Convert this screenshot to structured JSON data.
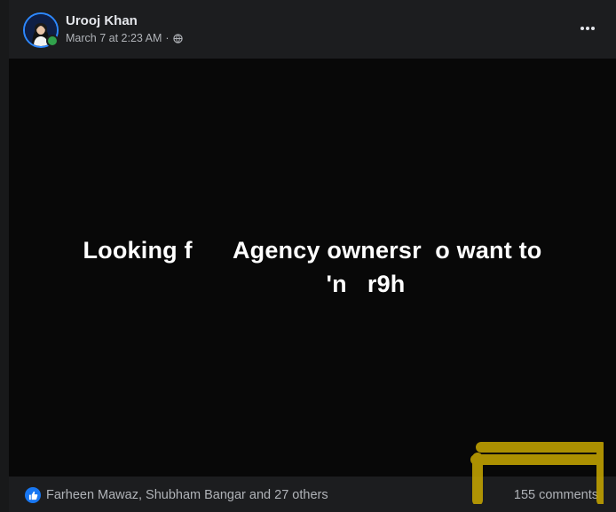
{
  "post": {
    "author": "Urooj Khan",
    "timestamp": "March 7 at 2:23 AM",
    "separator": "·",
    "audience_icon": "globe-icon",
    "more_icon": "more-horizontal-icon",
    "text_line1": "Looking f      Agency ownersr  o want to",
    "text_line2": "'n   r9h"
  },
  "footer": {
    "reaction_icon": "like-icon",
    "reactions_text": "Farheen Mawaz, Shubham Bangar and 27 others",
    "comments_text": "155 comments"
  },
  "colors": {
    "accent": "#1877f2",
    "online": "#31a24c",
    "highlight": "#c9a800"
  }
}
